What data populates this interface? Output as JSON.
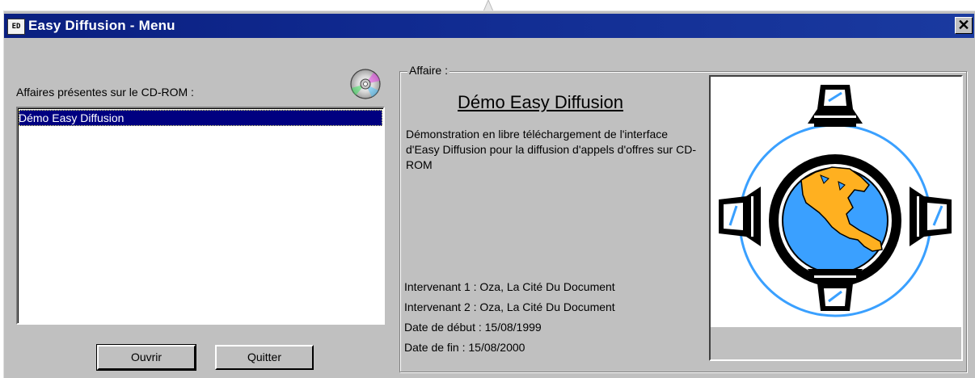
{
  "window": {
    "title": "Easy Diffusion - Menu",
    "app_icon_label": "ED",
    "close_label": "✕",
    "titlebar_color": "#0a1f80"
  },
  "left": {
    "label": "Affaires présentes sur le CD-ROM :",
    "list_items": [
      "Démo Easy Diffusion"
    ],
    "selected_index": 0,
    "cd_icon": "cd-rom-icon"
  },
  "buttons": {
    "open": "Ouvrir",
    "quit": "Quitter"
  },
  "affaire": {
    "group_label": "Affaire :",
    "title": "Démo Easy Diffusion",
    "description": "Démonstration en libre téléchargement de l'interface d'Easy Diffusion pour la diffusion d'appels d'offres sur CD-ROM",
    "intervenant1": "Intervenant 1 : Oza, La Cité Du Document",
    "intervenant2": "Intervenant 2 : Oza, La Cité Du Document",
    "date_debut": "Date de début : 15/08/1999",
    "date_fin": "Date de fin : 15/08/2000",
    "image": "globe-network-logo"
  },
  "colors": {
    "selection": "#000080",
    "globe_ocean": "#3aa0ff",
    "globe_land": "#ffb020"
  }
}
